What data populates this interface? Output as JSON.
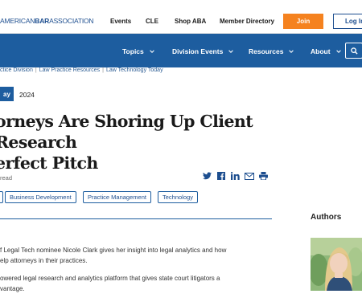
{
  "topbar": {
    "brand_prefix": "AMERICAN",
    "brand_bold": "BAR",
    "brand_suffix": "ASSOCIATION",
    "links": [
      "Events",
      "CLE",
      "Shop ABA",
      "Member Directory"
    ],
    "join_label": "Join",
    "login_label": "Log In"
  },
  "nav": {
    "items": [
      "Topics",
      "Division Events",
      "Resources",
      "About"
    ]
  },
  "breadcrumb": {
    "items": [
      "ctice Division",
      "Law Practice Resources",
      "Law Technology Today"
    ]
  },
  "article": {
    "date_badge": "ay",
    "date_year": "2024",
    "title_line1": "orneys Are Shoring Up Client Research",
    "title_line2": "erfect Pitch",
    "read_time": "read",
    "tags": [
      "",
      "Business Development",
      "Practice Management",
      "Technology"
    ],
    "paragraph1_line1": "f Legal Tech nominee Nicole Clark gives her insight into legal analytics and how",
    "paragraph1_line2": "elp attorneys in their practices.",
    "paragraph2_line1": "owered legal research and analytics platform that gives state court litigators a",
    "paragraph2_line2": "vantage."
  },
  "share": {
    "icons": [
      "twitter-icon",
      "facebook-icon",
      "linkedin-icon",
      "email-icon",
      "print-icon"
    ]
  },
  "sidebar": {
    "authors_heading": "Authors"
  },
  "colors": {
    "brand_blue": "#1d5d9f",
    "join_orange": "#f5821f"
  }
}
